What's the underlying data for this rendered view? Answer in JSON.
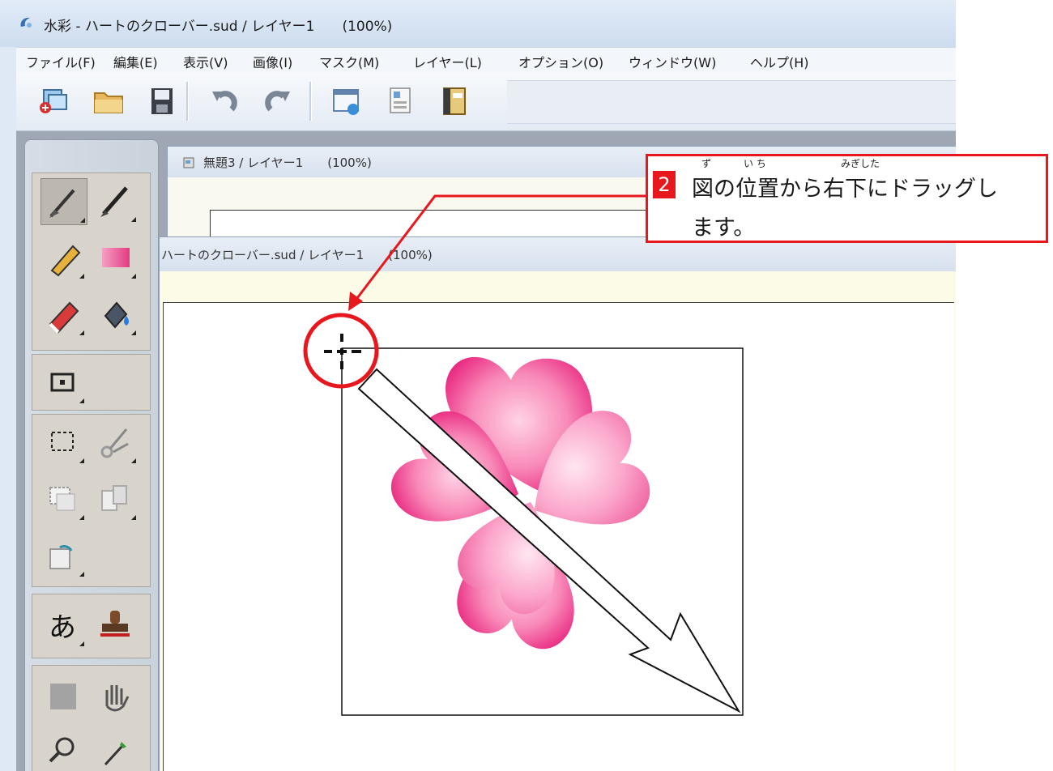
{
  "window": {
    "title": "水彩 - ハートのクローバー.sud / レイヤー1　　(100%)"
  },
  "menu": [
    {
      "label": "ファイル(F)"
    },
    {
      "label": "編集(E)"
    },
    {
      "label": "表示(V)"
    },
    {
      "label": "画像(I)"
    },
    {
      "label": "マスク(M)"
    },
    {
      "label": "レイヤー(L)"
    },
    {
      "label": "オプション(O)"
    },
    {
      "label": "ウィンドウ(W)"
    },
    {
      "label": "ヘルプ(H)"
    }
  ],
  "documents": {
    "back": {
      "title": "無題3 / レイヤー1　　(100%)"
    },
    "front": {
      "title": "ハートのクローバー.sud / レイヤー1　　(100%)"
    }
  },
  "callout": {
    "step": "2",
    "line1": "図の位置から右下にドラッグし",
    "line2": "ます。",
    "ruby": [
      {
        "text": "ず"
      },
      {
        "text": "い ち"
      },
      {
        "text": "みぎした"
      }
    ]
  },
  "colors": {
    "callout_red": "#e8171e",
    "heart_pink": "#f0308a",
    "heart_light": "#ffc2dd"
  }
}
